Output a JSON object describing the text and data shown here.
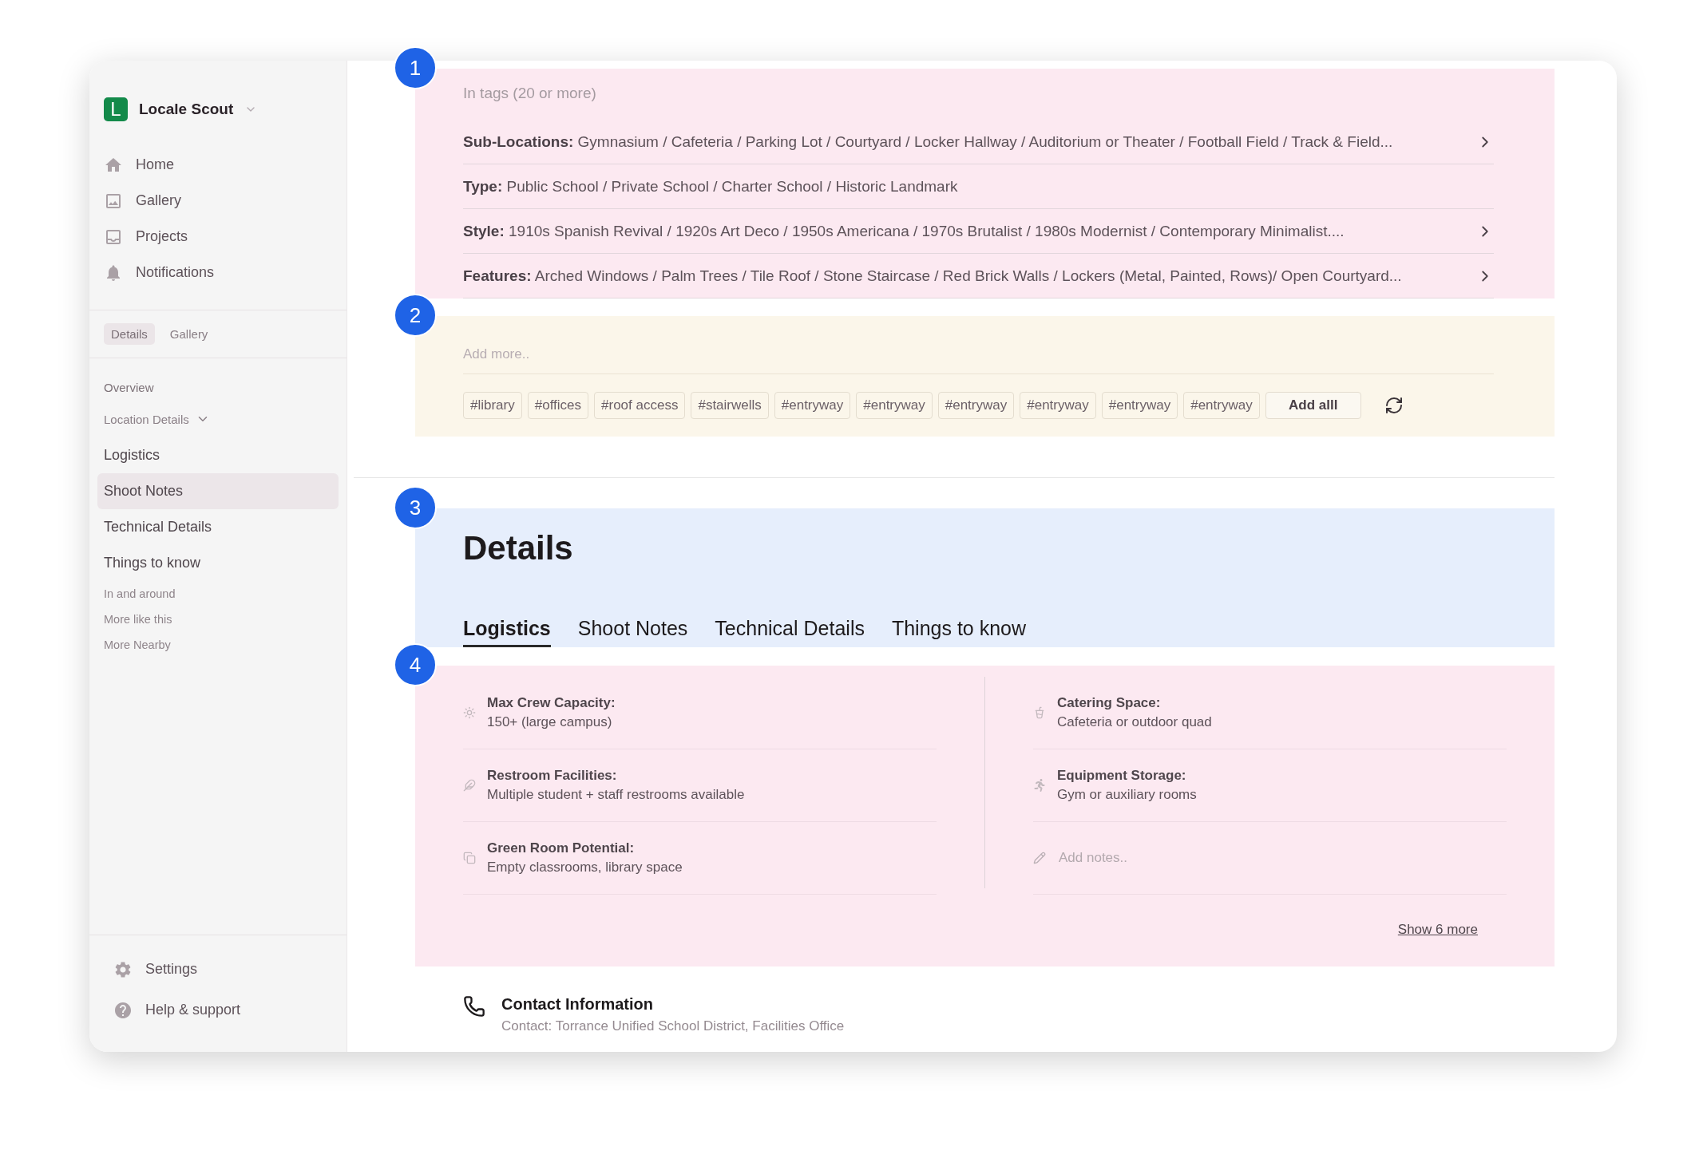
{
  "app": {
    "logo_letter": "L",
    "name": "Locale Scout"
  },
  "nav": [
    {
      "label": "Home"
    },
    {
      "label": "Gallery"
    },
    {
      "label": "Projects"
    },
    {
      "label": "Notifications"
    }
  ],
  "sidebar_tabs": [
    {
      "label": "Details",
      "selected": true
    },
    {
      "label": "Gallery",
      "selected": false
    }
  ],
  "outline": [
    {
      "kind": "heading",
      "label": "Overview",
      "selected": false
    },
    {
      "kind": "group",
      "label": "Location Details",
      "expanded": true,
      "selected": false,
      "children": [
        {
          "kind": "page",
          "label": "Logistics",
          "selected": false
        },
        {
          "kind": "page",
          "label": "Shoot Notes",
          "selected": true
        },
        {
          "kind": "page",
          "label": "Technical Details",
          "selected": false
        },
        {
          "kind": "page",
          "label": "Things to know",
          "selected": false
        }
      ]
    },
    {
      "kind": "link",
      "label": "In and around",
      "selected": false
    },
    {
      "kind": "link",
      "label": "More like this",
      "selected": false
    },
    {
      "kind": "link",
      "label": "More Nearby",
      "selected": false
    }
  ],
  "footer_nav": [
    {
      "label": "Settings"
    },
    {
      "label": "Help & support"
    }
  ],
  "tags_section": {
    "badge": "1",
    "title": "In tags (20 or more)",
    "rows": [
      {
        "label": "Sub-Locations:",
        "value": "Gymnasium / Cafeteria / Parking Lot / Courtyard / Locker Hallway / Auditorium or Theater / Football Field / Track & Field...",
        "expandable": true
      },
      {
        "label": "Type:",
        "value": "Public School / Private School / Charter School / Historic Landmark",
        "expandable": false
      },
      {
        "label": "Style:",
        "value": "1910s Spanish Revival / 1920s Art Deco / 1950s Americana / 1970s Brutalist / 1980s Modernist / Contemporary Minimalist....",
        "expandable": true
      },
      {
        "label": "Features:",
        "value": "Arched Windows / Palm Trees / Tile Roof / Stone Staircase / Red Brick Walls / Lockers (Metal, Painted, Rows)/ Open Courtyard...",
        "expandable": true
      }
    ]
  },
  "suggestions": {
    "badge": "2",
    "placeholder": "Add more..",
    "tags": [
      "#library",
      "#offices",
      "#roof access",
      "#stairwells",
      "#entryway",
      "#entryway",
      "#entryway",
      "#entryway",
      "#entryway",
      "#entryway"
    ],
    "add_all": "Add alll"
  },
  "details": {
    "badge": "3",
    "title": "Details",
    "tabs": [
      {
        "label": "Logistics",
        "selected": true
      },
      {
        "label": "Shoot Notes",
        "selected": false
      },
      {
        "label": "Technical Details",
        "selected": false
      },
      {
        "label": "Things to know",
        "selected": false
      }
    ]
  },
  "logistics": {
    "badge": "4",
    "left": [
      {
        "label": "Max Crew Capacity:",
        "value": "150+ (large campus)"
      },
      {
        "label": "Restroom Facilities:",
        "value": "Multiple student + staff restrooms available"
      },
      {
        "label": "Green Room Potential:",
        "value": "Empty classrooms, library space"
      }
    ],
    "right": [
      {
        "label": "Catering Space:",
        "value": "Cafeteria or outdoor quad"
      },
      {
        "label": "Equipment Storage:",
        "value": "Gym or auxiliary rooms"
      }
    ],
    "notes_placeholder": "Add notes..",
    "show_more": "Show 6 more"
  },
  "contact": {
    "title": "Contact Information",
    "line": "Contact: Torrance Unified School District, Facilities Office"
  }
}
